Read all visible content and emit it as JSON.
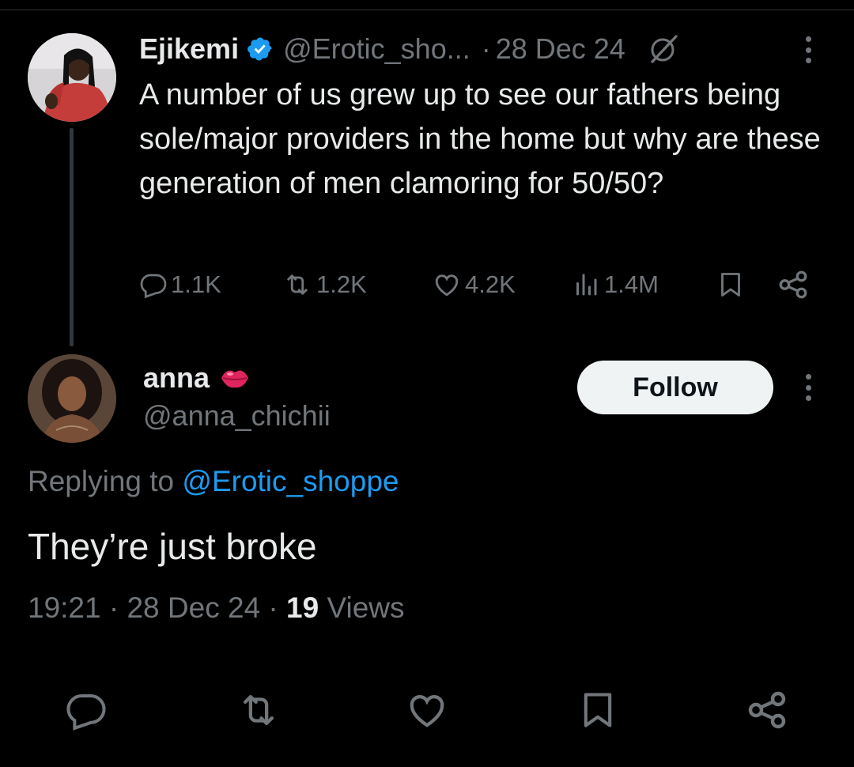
{
  "parent_tweet": {
    "author_name": "Ejikemi",
    "handle": "@Erotic_sho...",
    "separator": "·",
    "date": "28 Dec 24",
    "text": "A number of us grew up to see our fathers being sole/major providers in the home but why are these generation of men clamoring for 50/50?",
    "stats": {
      "replies": "1.1K",
      "reposts": "1.2K",
      "likes": "4.2K",
      "views": "1.4M"
    },
    "icons": [
      "verified-badge-icon",
      "grok-icon",
      "more-icon",
      "reply-icon",
      "repost-icon",
      "like-icon",
      "views-icon",
      "bookmark-icon",
      "share-icon"
    ]
  },
  "reply_tweet": {
    "author_name": "anna",
    "handle": "@anna_chichii",
    "follow_label": "Follow",
    "replying_prefix": "Replying to ",
    "replying_to": "@Erotic_shoppe",
    "text": "They’re just broke",
    "time": "19:21",
    "sep1": " · ",
    "date": "28 Dec 24",
    "sep2": " · ",
    "views_count": "19",
    "views_label": " Views",
    "icons": [
      "kiss-lips-icon",
      "more-icon"
    ]
  },
  "bottom_actions": [
    "reply-icon",
    "repost-icon",
    "like-icon",
    "bookmark-icon",
    "share-icon"
  ],
  "colors": {
    "background": "#000000",
    "text": "#e7e9ea",
    "muted": "#71767b",
    "link": "#1d9bf0",
    "verified": "#1d9bf0",
    "follow_button_bg": "#eff3f4",
    "divider": "#2f3336"
  }
}
